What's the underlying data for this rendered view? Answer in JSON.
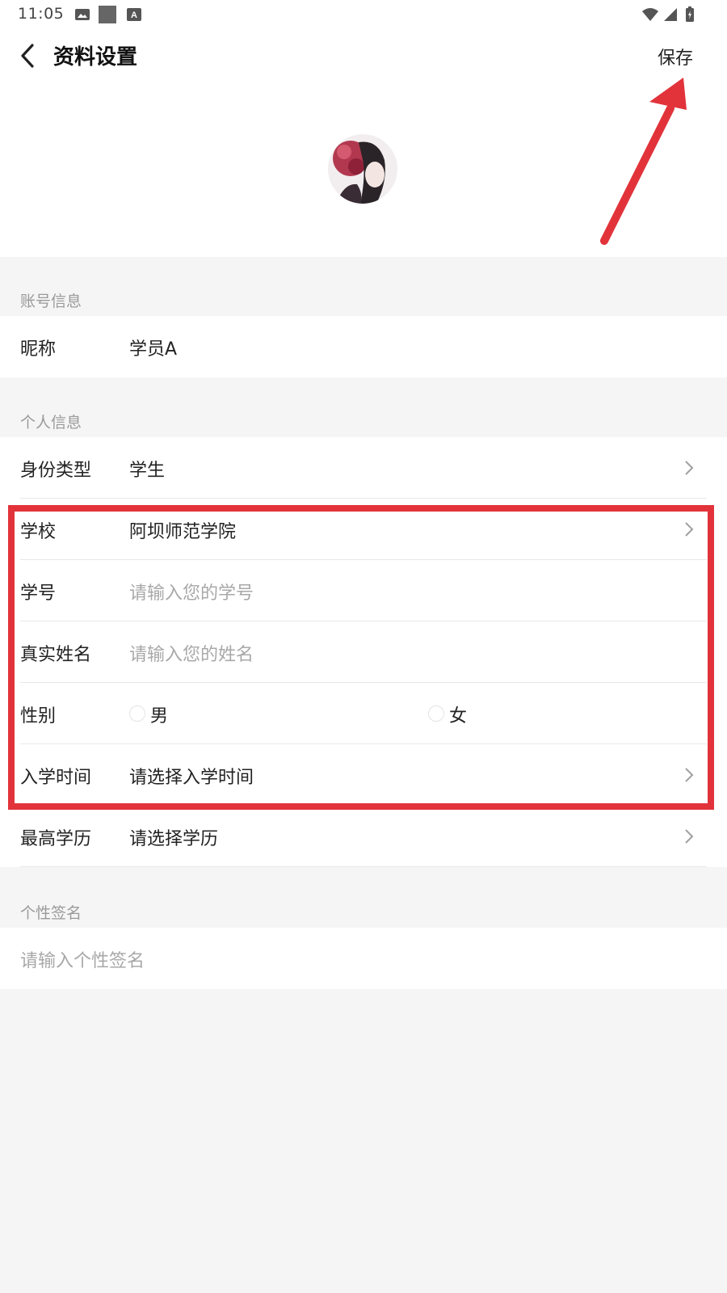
{
  "status_bar": {
    "time": "11:05"
  },
  "header": {
    "title": "资料设置",
    "save_label": "保存"
  },
  "sections": {
    "account": {
      "title": "账号信息",
      "nickname": {
        "label": "昵称",
        "value": "学员A"
      }
    },
    "personal": {
      "title": "个人信息",
      "identity": {
        "label": "身份类型",
        "value": "学生"
      },
      "school": {
        "label": "学校",
        "value": "阿坝师范学院"
      },
      "student_id": {
        "label": "学号",
        "placeholder": "请输入您的学号"
      },
      "real_name": {
        "label": "真实姓名",
        "placeholder": "请输入您的姓名"
      },
      "gender": {
        "label": "性别",
        "options": [
          "男",
          "女"
        ]
      },
      "enroll_time": {
        "label": "入学时间",
        "value": "请选择入学时间"
      },
      "education": {
        "label": "最高学历",
        "value": "请选择学历"
      }
    },
    "signature": {
      "title": "个性签名",
      "placeholder": "请输入个性签名"
    }
  },
  "annotation_color": "#e2333b",
  "icons": [
    "back-arrow-icon",
    "chevron-right-icon",
    "wifi-icon",
    "signal-icon",
    "battery-icon",
    "image-icon",
    "app-icon",
    "text-icon"
  ]
}
